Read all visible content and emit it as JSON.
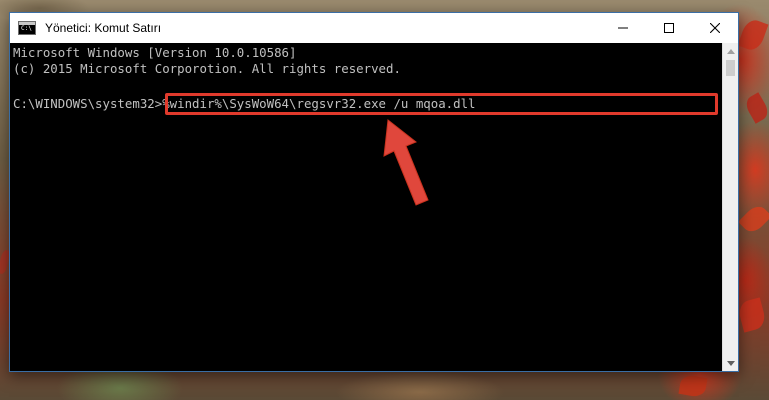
{
  "window": {
    "title": "Yönetici: Komut Satırı",
    "icon": "console-icon",
    "icon_glyph": "C:\\"
  },
  "controls": {
    "minimize_icon": "minimize-icon",
    "maximize_icon": "maximize-icon",
    "close_icon": "close-icon"
  },
  "console": {
    "lines": [
      "Microsoft Windows [Version 10.0.10586]",
      "(c) 2015 Microsoft Corporotion. All rights reserved."
    ],
    "prompt": "C:\\WINDOWS\\system32>",
    "command": "%windir%\\SysWoW64\\regsvr32.exe /u mqoa.dll"
  },
  "annotation": {
    "highlight_color": "#e03a2c",
    "arrow_color": "#e0473c"
  },
  "colors": {
    "console_bg": "#000000",
    "console_text": "#c0c0c0",
    "titlebar_bg": "#ffffff"
  }
}
